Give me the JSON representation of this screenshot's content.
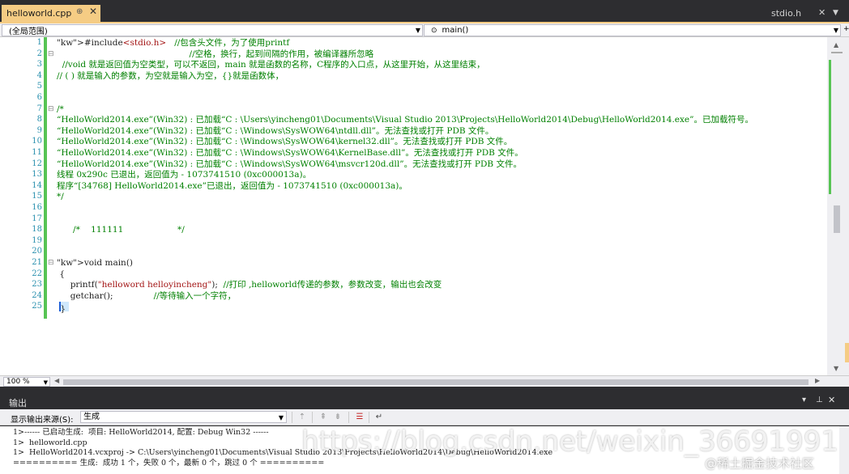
{
  "tabs": {
    "active": {
      "label": "helloworld.cpp",
      "pin_icon": "pin-icon",
      "close_icon": "close-icon"
    },
    "right": {
      "label": "stdio.h",
      "close_glyph": "✕",
      "dropdown_glyph": "▼"
    }
  },
  "navbar": {
    "scope": "(全局范围)",
    "function": "main()",
    "function_icon": "function-icon"
  },
  "editor": {
    "lines": [
      {
        "n": "1",
        "text": "#include<stdio.h>   //包含头文件，为了使用printf"
      },
      {
        "n": "2",
        "text": "                                                 //空格，换行，起到间隔的作用，被编译器所忽略"
      },
      {
        "n": "3",
        "text": "  //void 就是返回值为空类型，可以不返回，main 就是函数的名称，C程序的入口点，从这里开始，从这里结束，"
      },
      {
        "n": "4",
        "text": "// ( ) 就是输入的参数，为空就是输入为空，{}就是函数体，"
      },
      {
        "n": "5",
        "text": ""
      },
      {
        "n": "6",
        "text": ""
      },
      {
        "n": "7",
        "text": "/*"
      },
      {
        "n": "8",
        "text": "“HelloWorld2014.exe”(Win32) : 已加载“C : \\Users\\yincheng01\\Documents\\Visual Studio 2013\\Projects\\HelloWorld2014\\Debug\\HelloWorld2014.exe”。已加载符号。"
      },
      {
        "n": "9",
        "text": "“HelloWorld2014.exe”(Win32) : 已加载“C : \\Windows\\SysWOW64\\ntdll.dll”。无法查找或打开 PDB 文件。"
      },
      {
        "n": "10",
        "text": "“HelloWorld2014.exe”(Win32) : 已加载“C : \\Windows\\SysWOW64\\kernel32.dll”。无法查找或打开 PDB 文件。"
      },
      {
        "n": "11",
        "text": "“HelloWorld2014.exe”(Win32) : 已加载“C : \\Windows\\SysWOW64\\KernelBase.dll”。无法查找或打开 PDB 文件。"
      },
      {
        "n": "12",
        "text": "“HelloWorld2014.exe”(Win32) : 已加载“C : \\Windows\\SysWOW64\\msvcr120d.dll”。无法查找或打开 PDB 文件。"
      },
      {
        "n": "13",
        "text": "线程 0x290c 已退出，返回值为 - 1073741510 (0xc000013a)。"
      },
      {
        "n": "14",
        "text": "程序“[34768] HelloWorld2014.exe”已退出，返回值为 - 1073741510 (0xc000013a)。"
      },
      {
        "n": "15",
        "text": "*/"
      },
      {
        "n": "16",
        "text": ""
      },
      {
        "n": "17",
        "text": ""
      },
      {
        "n": "18",
        "text": "      /*    111111                    */"
      },
      {
        "n": "19",
        "text": ""
      },
      {
        "n": "20",
        "text": ""
      },
      {
        "n": "21",
        "text": "void main()"
      },
      {
        "n": "22",
        "text": " {"
      },
      {
        "n": "23",
        "text": "     printf(\"helloword helloyincheng\");  //打印 ,helloworld传递的参数，参数改变，输出也会改变"
      },
      {
        "n": "24",
        "text": "     getchar();               //等待输入一个字符，"
      },
      {
        "n": "25",
        "text": " }"
      }
    ]
  },
  "zoom": {
    "value": "100 %"
  },
  "output": {
    "title": "输出",
    "source_label": "显示输出来源(S):",
    "source_value": "生成",
    "controls": [
      "▾",
      "⊥",
      "✕"
    ],
    "icons": [
      "find-icon",
      "prev-message-icon",
      "next-message-icon",
      "clear-all-icon",
      "word-wrap-icon"
    ],
    "lines": [
      "1>------ 已启动生成:  项目: HelloWorld2014, 配置: Debug Win32 ------",
      "1>  helloworld.cpp",
      "1>  HelloWorld2014.vcxproj -> C:\\Users\\yincheng01\\Documents\\Visual Studio 2013\\Projects\\HelloWorld2014\\Debug\\HelloWorld2014.exe",
      "========== 生成:  成功 1 个，失败 0 个，最新 0 个，跳过 0 个 =========="
    ]
  },
  "watermark": {
    "url": "https://blog.csdn.net/weixin_36691991",
    "site": "@稀土掘金技术社区"
  },
  "colors": {
    "active_tab": "#f5cc84",
    "change_bar": "#57c454",
    "chrome": "#2d2d30",
    "line_number": "#2b91af"
  }
}
